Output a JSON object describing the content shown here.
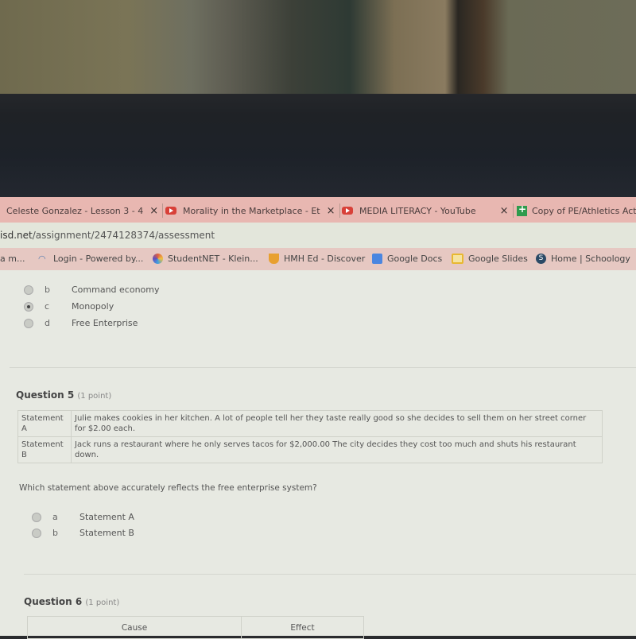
{
  "browser": {
    "tabs": [
      {
        "title": "Celeste Gonzalez - Lesson 3 - 4",
        "icon": "none",
        "close": "×"
      },
      {
        "title": "Morality in the Marketplace - Et",
        "icon": "youtube-icon",
        "close": "×"
      },
      {
        "title": "MEDIA LITERACY - YouTube",
        "icon": "youtube-icon",
        "close": "×"
      },
      {
        "title": "Copy of PE/Athletics Acti",
        "icon": "google-sheets-icon"
      }
    ],
    "url": {
      "domain": "isd.net",
      "path": "/assignment/2474128374/assessment"
    },
    "bookmarks": [
      {
        "label": "a m..."
      },
      {
        "label": "Login - Powered by...",
        "icon": "wifi-icon"
      },
      {
        "label": "StudentNET - Klein...",
        "icon": "studentnet-icon"
      },
      {
        "label": "HMH Ed - Discover",
        "icon": "hmh-icon"
      },
      {
        "label": "Google Docs",
        "icon": "google-docs-icon"
      },
      {
        "label": "Google Slides",
        "icon": "google-slides-icon"
      },
      {
        "label": "Home | Schoology",
        "icon": "schoology-icon"
      }
    ]
  },
  "question4": {
    "options": [
      {
        "letter": "b",
        "text": "Command economy",
        "selected": false
      },
      {
        "letter": "c",
        "text": "Monopoly",
        "selected": true
      },
      {
        "letter": "d",
        "text": "Free Enterprise",
        "selected": false
      }
    ]
  },
  "question5": {
    "title": "Question 5",
    "points": "(1 point)",
    "statements": [
      {
        "label": "Statement A",
        "text": "Julie makes cookies in her kitchen. A lot of people tell her they taste really good so she decides to sell them on her street corner for $2.00 each."
      },
      {
        "label": "Statement B",
        "text": "Jack runs a restaurant where he only serves tacos for $2,000.00 The city decides they cost too much and shuts his restaurant down."
      }
    ],
    "prompt": "Which statement above accurately reflects the free enterprise system?",
    "options": [
      {
        "letter": "a",
        "text": "Statement A",
        "selected": false
      },
      {
        "letter": "b",
        "text": "Statement B",
        "selected": false
      }
    ]
  },
  "question6": {
    "title": "Question 6",
    "points": "(1 point)",
    "headers": [
      "Cause",
      "Effect"
    ]
  }
}
